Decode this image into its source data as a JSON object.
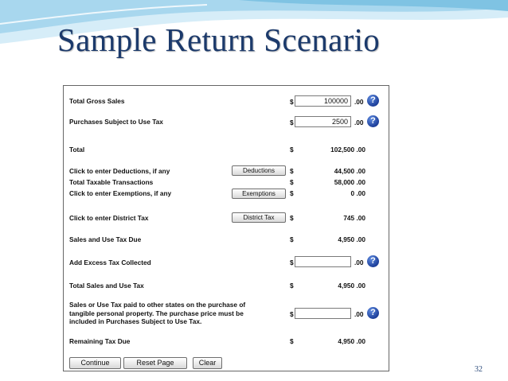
{
  "slide": {
    "title": "Sample Return Scenario",
    "number": "32"
  },
  "form": {
    "currency_symbol": "$",
    "cents_suffix": ".00",
    "help_glyph": "?",
    "rows": {
      "gross_sales": {
        "label": "Total Gross Sales",
        "input_value": "100000"
      },
      "purchases_use_tax": {
        "label": "Purchases Subject to Use Tax",
        "input_value": "2500"
      },
      "total": {
        "label": "Total",
        "amount": "102,500 .00"
      },
      "deductions": {
        "label": "Click to enter Deductions, if any",
        "button": "Deductions",
        "amount": "44,500 .00"
      },
      "taxable": {
        "label": "Total Taxable Transactions",
        "amount": "58,000 .00"
      },
      "exemptions": {
        "label": "Click to enter Exemptions, if any",
        "button": "Exemptions",
        "amount": "0 .00"
      },
      "district": {
        "label": "Click to enter District Tax",
        "button": "District Tax",
        "amount": "745 .00"
      },
      "sales_use_due": {
        "label": "Sales and Use Tax Due",
        "amount": "4,950 .00"
      },
      "excess": {
        "label": "Add Excess Tax Collected",
        "input_value": ""
      },
      "total_sales_use": {
        "label": "Total Sales and Use Tax",
        "amount": "4,950 .00"
      },
      "other_states": {
        "label": "Sales or Use Tax paid to other states on the purchase of tangible personal property. The purchase price must be included in Purchases Subject to Use Tax.",
        "input_value": ""
      },
      "remaining": {
        "label": "Remaining Tax Due",
        "amount": "4,950 .00"
      }
    },
    "buttons": {
      "continue": "Continue",
      "reset": "Reset Page",
      "clear": "Clear"
    }
  },
  "colors": {
    "title": "#1c3a6b",
    "swoosh_light": "#c9e6f4",
    "swoosh_dark": "#7fc3e3",
    "help_icon": "#1d3f9a"
  }
}
